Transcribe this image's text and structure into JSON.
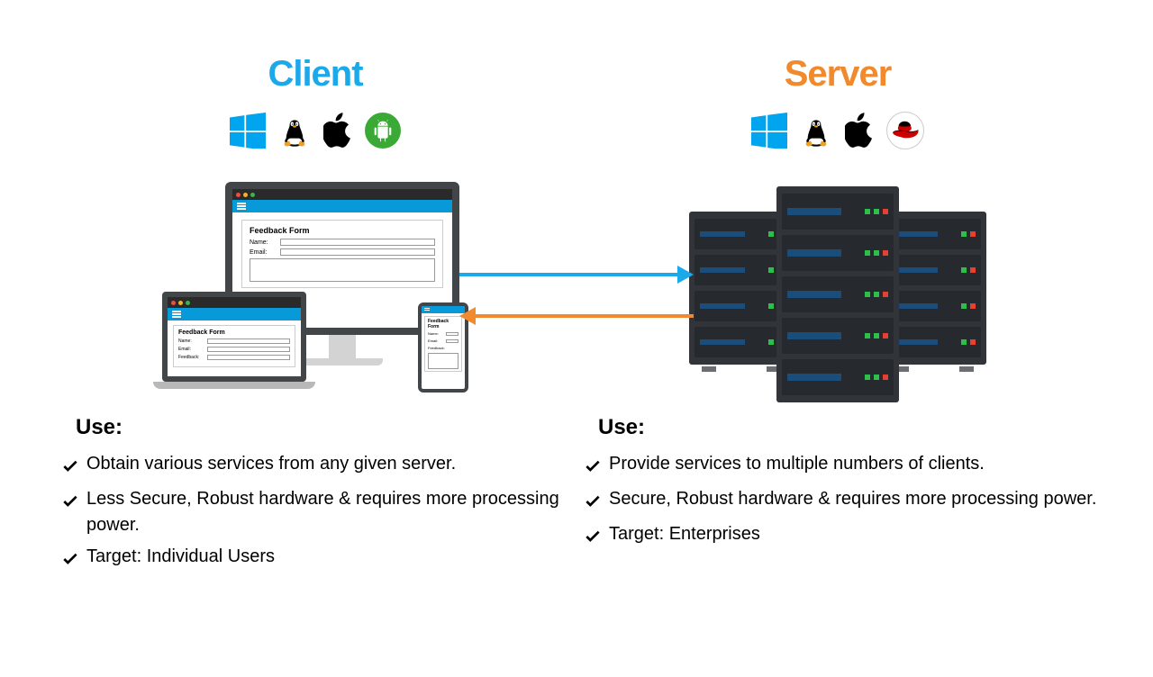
{
  "client": {
    "title": "Client",
    "os_icons": [
      "windows",
      "linux",
      "apple",
      "android"
    ],
    "form": {
      "title": "Feedback Form",
      "fields": {
        "name": "Name:",
        "email": "Email:",
        "feedback": "Feedback:"
      }
    },
    "use_heading": "Use:",
    "use_items": [
      "Obtain various services from any given server.",
      "Less Secure, Robust hardware & requires more processing power.",
      "Target: Individual Users"
    ]
  },
  "server": {
    "title": "Server",
    "os_icons": [
      "windows",
      "linux",
      "apple",
      "redhat"
    ],
    "use_heading": "Use:",
    "use_items": [
      "Provide services to multiple numbers of clients.",
      "Secure, Robust hardware & requires more processing power.",
      "Target: Enterprises"
    ]
  },
  "colors": {
    "client": "#1CA9E9",
    "server": "#F08A2C"
  }
}
